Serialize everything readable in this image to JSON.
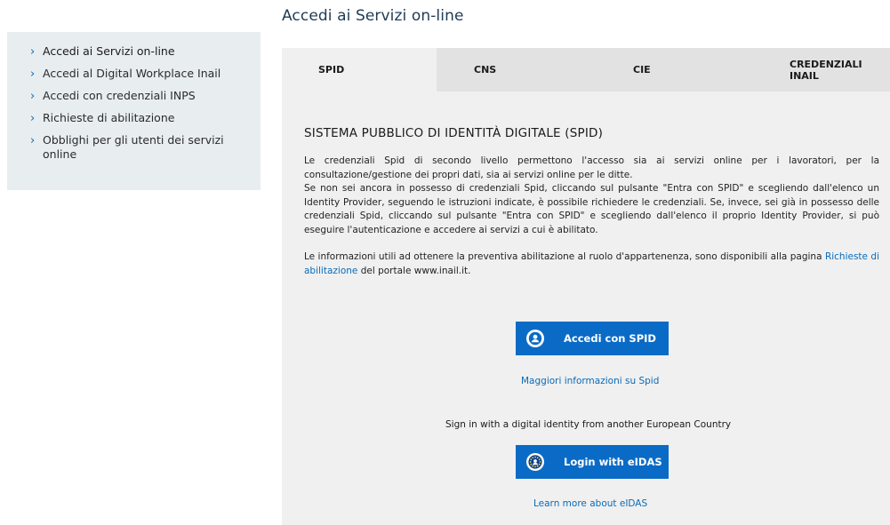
{
  "sidebar": {
    "items": [
      {
        "label": "Accedi ai Servizi on-line"
      },
      {
        "label": "Accedi al Digital Workplace Inail"
      },
      {
        "label": "Accedi con credenziali INPS"
      },
      {
        "label": "Richieste di abilitazione"
      },
      {
        "label": "Obblighi per gli utenti dei servizi online"
      }
    ]
  },
  "page": {
    "title": "Accedi ai Servizi on-line"
  },
  "tabs": [
    {
      "label": "SPID"
    },
    {
      "label": "CNS"
    },
    {
      "label": "CIE"
    },
    {
      "label": "CREDENZIALI INAIL"
    }
  ],
  "spid": {
    "section_title": "SISTEMA PUBBLICO DI IDENTITÀ DIGITALE (SPID)",
    "para1": "Le credenziali Spid di secondo livello permettono l'accesso sia ai servizi online per i lavoratori, per la consultazione/gestione dei propri dati, sia ai servizi online per le ditte.",
    "para2": "Se non sei ancora in possesso di credenziali Spid, cliccando sul pulsante \"Entra con SPID\" e scegliendo dall'elenco un Identity Provider, seguendo le istruzioni indicate, è possibile richiedere le credenziali. Se, invece, sei già in possesso delle credenziali Spid, cliccando sul pulsante \"Entra con SPID\" e scegliendo dall'elenco il proprio Identity Provider, si può eseguire l'autenticazione e accedere ai servizi a cui è abilitato.",
    "para3_before": "Le informazioni utili ad ottenere la preventiva abilitazione al ruolo d'appartenenza, sono disponibili alla pagina ",
    "para3_link": "Richieste di abilitazione",
    "para3_after": " del portale www.inail.it.",
    "button_label": "Accedi con SPID",
    "more_info_link": "Maggiori informazioni su Spid",
    "eu_note": "Sign in with a digital identity from another European Country",
    "eidas_button_label": "Login with eIDAS",
    "eidas_more_link": "Learn more about eIDAS"
  },
  "colors": {
    "accent": "#0a6bc6",
    "link": "#0a6bb8",
    "sidebar_bg": "#e8edf0",
    "panel_bg": "#f0f0f0",
    "tab_bg": "#e2e2e2"
  },
  "icons": {
    "sidebar_bullet": "chevron-right-icon",
    "spid_button": "user-icon",
    "eidas_button": "eu-stars-icon"
  }
}
